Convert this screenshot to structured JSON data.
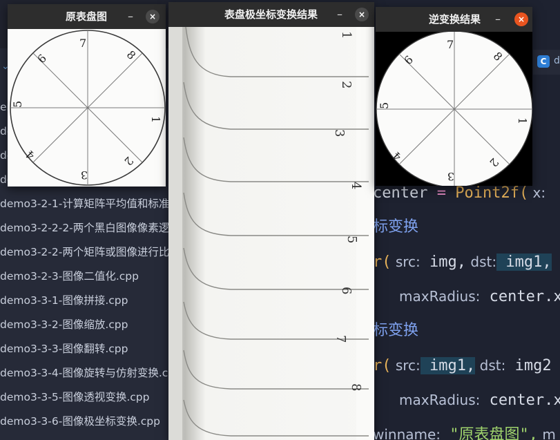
{
  "ide": {
    "file_items": [
      {
        "label": "en"
      },
      {
        "label": "de"
      },
      {
        "label": "de"
      },
      {
        "label": "de"
      },
      {
        "label": "demo3-2-1-计算矩阵平均值和标准"
      },
      {
        "label": "demo3-2-2-2-两个黑白图像像素逻"
      },
      {
        "label": "demo3-2-2-两个矩阵或图像进行比"
      },
      {
        "label": "demo3-2-3-图像二值化.cpp"
      },
      {
        "label": "demo3-3-1-图像拼接.cpp"
      },
      {
        "label": "demo3-3-2-图像缩放.cpp"
      },
      {
        "label": "demo3-3-3-图像翻转.cpp"
      },
      {
        "label": "demo3-3-4-图像旋转与仿射变换.c"
      },
      {
        "label": "demo3-3-5-图像透视变换.cpp"
      },
      {
        "label": "demo3-3-6-图像极坐标变换.cpp"
      }
    ],
    "tab": {
      "icon": "C",
      "label": "d"
    },
    "code": {
      "l1_a": "center",
      "l1_b": " = ",
      "l1_c": "Point2f(",
      "l1_d": " x:",
      "l2": "标变换",
      "l3_a": "r(",
      "l3_b": " src:",
      "l3_c": " img,",
      "l3_d": "  dst:",
      "l3_e": " img1,",
      "l4_a": "maxRadius:",
      "l4_b": " center.x",
      "l5": "标变换",
      "l6_a": "r(",
      "l6_b": " src:",
      "l6_c": " img1,",
      "l6_d": "  dst:",
      "l6_e": " img2",
      "l7_a": "maxRadius:",
      "l7_b": " center.x",
      "l8_a": "winname:",
      "l8_b": " \"原表盘图\",",
      "l8_c": "  m"
    }
  },
  "windows": {
    "original": {
      "title": "原表盘图",
      "min": "–",
      "close": "×"
    },
    "polar": {
      "title": "表盘极坐标变换结果",
      "min": "–",
      "close": "×"
    },
    "inverse": {
      "title": "逆变换结果",
      "min": "–",
      "close": "×"
    }
  },
  "dial": {
    "numbers": [
      "1",
      "2",
      "3",
      "4",
      "5",
      "6",
      "7",
      "8"
    ]
  },
  "colors": {
    "close_active": "#e9541f",
    "titlebar": "#2d2d2d",
    "ide_bg": "#1e2230"
  }
}
